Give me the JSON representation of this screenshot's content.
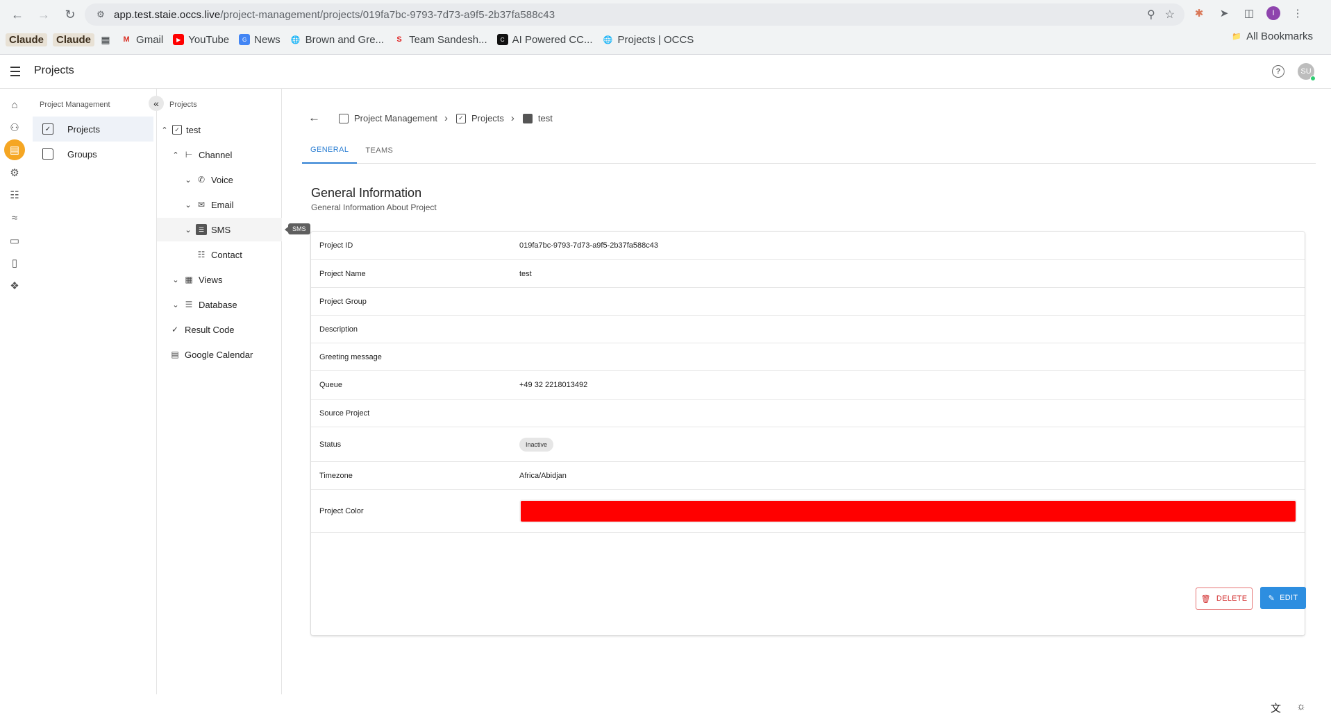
{
  "browser": {
    "url_host": "app.test.staie.occs.live",
    "url_path": "/project-management/projects/019fa7bc-9793-7d73-a9f5-2b37fa588c43",
    "profile_initial": "I",
    "bookmarks": [
      "Claude",
      "Claude",
      "Gmail",
      "YouTube",
      "News",
      "Brown and Gre...",
      "Team Sandesh...",
      "AI Powered CC...",
      "Projects | OCCS"
    ],
    "all_bookmarks_label": "All Bookmarks"
  },
  "header": {
    "title": "Projects",
    "avatar_initials": "SU"
  },
  "rail_icons": [
    "home-icon",
    "users-icon",
    "projects-icon",
    "settings-icon",
    "contacts-icon",
    "reports-icon",
    "monitor-icon",
    "clipboard-icon",
    "puzzle-icon"
  ],
  "panel1": {
    "heading": "Project Management",
    "items": [
      {
        "label": "Projects",
        "selected": true
      },
      {
        "label": "Groups",
        "selected": false
      }
    ]
  },
  "panel2": {
    "heading": "Projects",
    "tree": [
      {
        "label": "test"
      },
      {
        "label": "Channel"
      },
      {
        "label": "Voice"
      },
      {
        "label": "Email"
      },
      {
        "label": "SMS"
      },
      {
        "label": "Contact"
      },
      {
        "label": "Views"
      },
      {
        "label": "Database"
      },
      {
        "label": "Result Code"
      },
      {
        "label": "Google Calendar"
      }
    ],
    "tooltip": "SMS"
  },
  "breadcrumb": [
    "Project Management",
    "Projects",
    "test"
  ],
  "tabs": [
    {
      "label": "GENERAL",
      "active": true
    },
    {
      "label": "TEAMS",
      "active": false
    }
  ],
  "general": {
    "title": "General Information",
    "subtitle": "General Information About Project",
    "rows": [
      {
        "label": "Project ID",
        "value": "019fa7bc-9793-7d73-a9f5-2b37fa588c43"
      },
      {
        "label": "Project Name",
        "value": "test"
      },
      {
        "label": "Project Group",
        "value": ""
      },
      {
        "label": "Description",
        "value": ""
      },
      {
        "label": "Greeting message",
        "value": ""
      },
      {
        "label": "Queue",
        "value": "+49 32 2218013492"
      },
      {
        "label": "Source Project",
        "value": ""
      },
      {
        "label": "Status",
        "value": "Inactive"
      },
      {
        "label": "Timezone",
        "value": "Africa/Abidjan"
      },
      {
        "label": "Project Color",
        "value": ""
      }
    ],
    "project_color": "#ff0000"
  },
  "actions": {
    "delete_label": "DELETE",
    "edit_label": "EDIT"
  },
  "colors": {
    "accent": "#2d8ee0",
    "rail_active": "#f5a623",
    "delete": "#d32f2f"
  }
}
